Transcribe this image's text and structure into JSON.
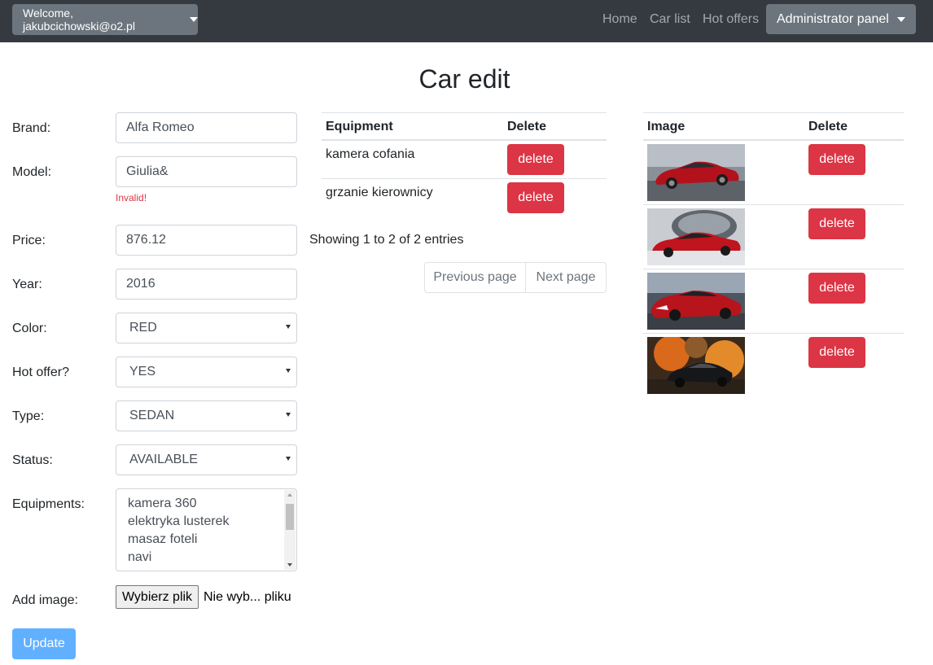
{
  "navbar": {
    "welcome": "Welcome, jakubcichowski@o2.pl",
    "links": [
      "Home",
      "Car list",
      "Hot offers"
    ],
    "admin_panel": "Administrator panel"
  },
  "page_title": "Car edit",
  "form": {
    "brand_label": "Brand:",
    "brand_value": "Alfa Romeo",
    "model_label": "Model:",
    "model_value": "Giulia&",
    "model_error": "Invalid!",
    "price_label": "Price:",
    "price_value": "876.12",
    "year_label": "Year:",
    "year_value": "2016",
    "color_label": "Color:",
    "color_value": "RED",
    "hot_offer_label": "Hot offer?",
    "hot_offer_value": "YES",
    "type_label": "Type:",
    "type_value": "SEDAN",
    "status_label": "Status:",
    "status_value": "AVAILABLE",
    "equipments_label": "Equipments:",
    "equipments_options": [
      "kamera 360",
      "elektryka lusterek",
      "masaz foteli",
      "navi"
    ],
    "add_image_label": "Add image:",
    "file_button": "Wybierz plik",
    "file_status": "Nie wyb... pliku",
    "update_button": "Update"
  },
  "equipment_table": {
    "headers": [
      "Equipment",
      "Delete"
    ],
    "rows": [
      {
        "name": "kamera cofania",
        "action": "delete"
      },
      {
        "name": "grzanie kierownicy",
        "action": "delete"
      }
    ],
    "showing": "Showing 1 to 2 of 2 entries",
    "previous_page": "Previous page",
    "next_page": "Next page"
  },
  "image_table": {
    "headers": [
      "Image",
      "Delete"
    ],
    "rows": [
      {
        "image": "red-sedan-road-photo",
        "action": "delete"
      },
      {
        "image": "red-sedan-studio-photo",
        "action": "delete"
      },
      {
        "image": "red-sedan-front-photo",
        "action": "delete"
      },
      {
        "image": "black-car-explosion-photo",
        "action": "delete"
      }
    ]
  },
  "colors": {
    "navbar_bg": "#343a40",
    "secondary_btn": "#6c757d",
    "danger": "#dc3545",
    "primary_disabled": "#61b0ff",
    "invalid_text": "#dc3545"
  }
}
